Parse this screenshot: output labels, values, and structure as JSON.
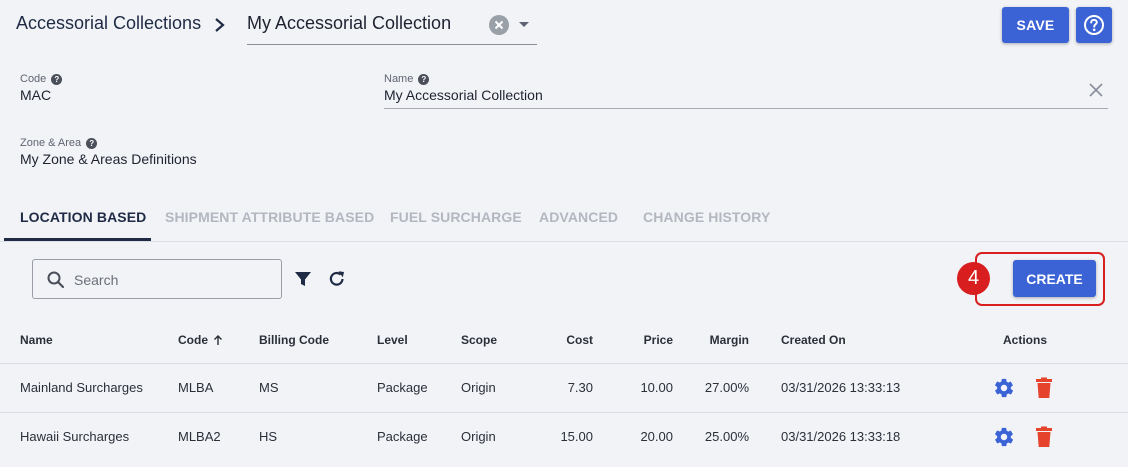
{
  "header": {
    "breadcrumb_root": "Accessorial Collections",
    "current_collection": "My Accessorial Collection",
    "save_label": "SAVE"
  },
  "fields": {
    "code": {
      "label": "Code",
      "value": "MAC"
    },
    "name": {
      "label": "Name",
      "value": "My Accessorial Collection"
    },
    "zone": {
      "label": "Zone & Area",
      "value": "My Zone & Areas Definitions"
    }
  },
  "tabs": [
    {
      "label": "LOCATION BASED",
      "active": true
    },
    {
      "label": "SHIPMENT ATTRIBUTE BASED",
      "active": false
    },
    {
      "label": "FUEL SURCHARGE",
      "active": false
    },
    {
      "label": "ADVANCED",
      "active": false
    },
    {
      "label": "CHANGE HISTORY",
      "active": false
    }
  ],
  "toolbar": {
    "search_placeholder": "Search",
    "create_label": "CREATE",
    "step_number": "4"
  },
  "table": {
    "columns": [
      "Name",
      "Code",
      "Billing Code",
      "Level",
      "Scope",
      "Cost",
      "Price",
      "Margin",
      "Created On",
      "Actions"
    ],
    "sort": {
      "column": "Code",
      "direction": "ascending"
    },
    "rows": [
      {
        "name": "Mainland Surcharges",
        "code": "MLBA",
        "billing_code": "MS",
        "level": "Package",
        "scope": "Origin",
        "cost": "7.30",
        "price": "10.00",
        "margin": "27.00%",
        "created_on": "03/31/2026 13:33:13"
      },
      {
        "name": "Hawaii Surcharges",
        "code": "MLBA2",
        "billing_code": "HS",
        "level": "Package",
        "scope": "Origin",
        "cost": "15.00",
        "price": "20.00",
        "margin": "25.00%",
        "created_on": "03/31/2026 13:33:18"
      }
    ]
  },
  "colors": {
    "primary": "#3b63d6",
    "highlight": "#d81e1e",
    "delete": "#e5432c",
    "background": "#f1f3f7"
  },
  "icons": [
    "chevron-right-icon",
    "clear-icon",
    "dropdown-caret-icon",
    "help-icon",
    "search-icon",
    "filter-icon",
    "refresh-icon",
    "sort-ascending-icon",
    "gear-icon",
    "trash-icon",
    "close-icon"
  ]
}
